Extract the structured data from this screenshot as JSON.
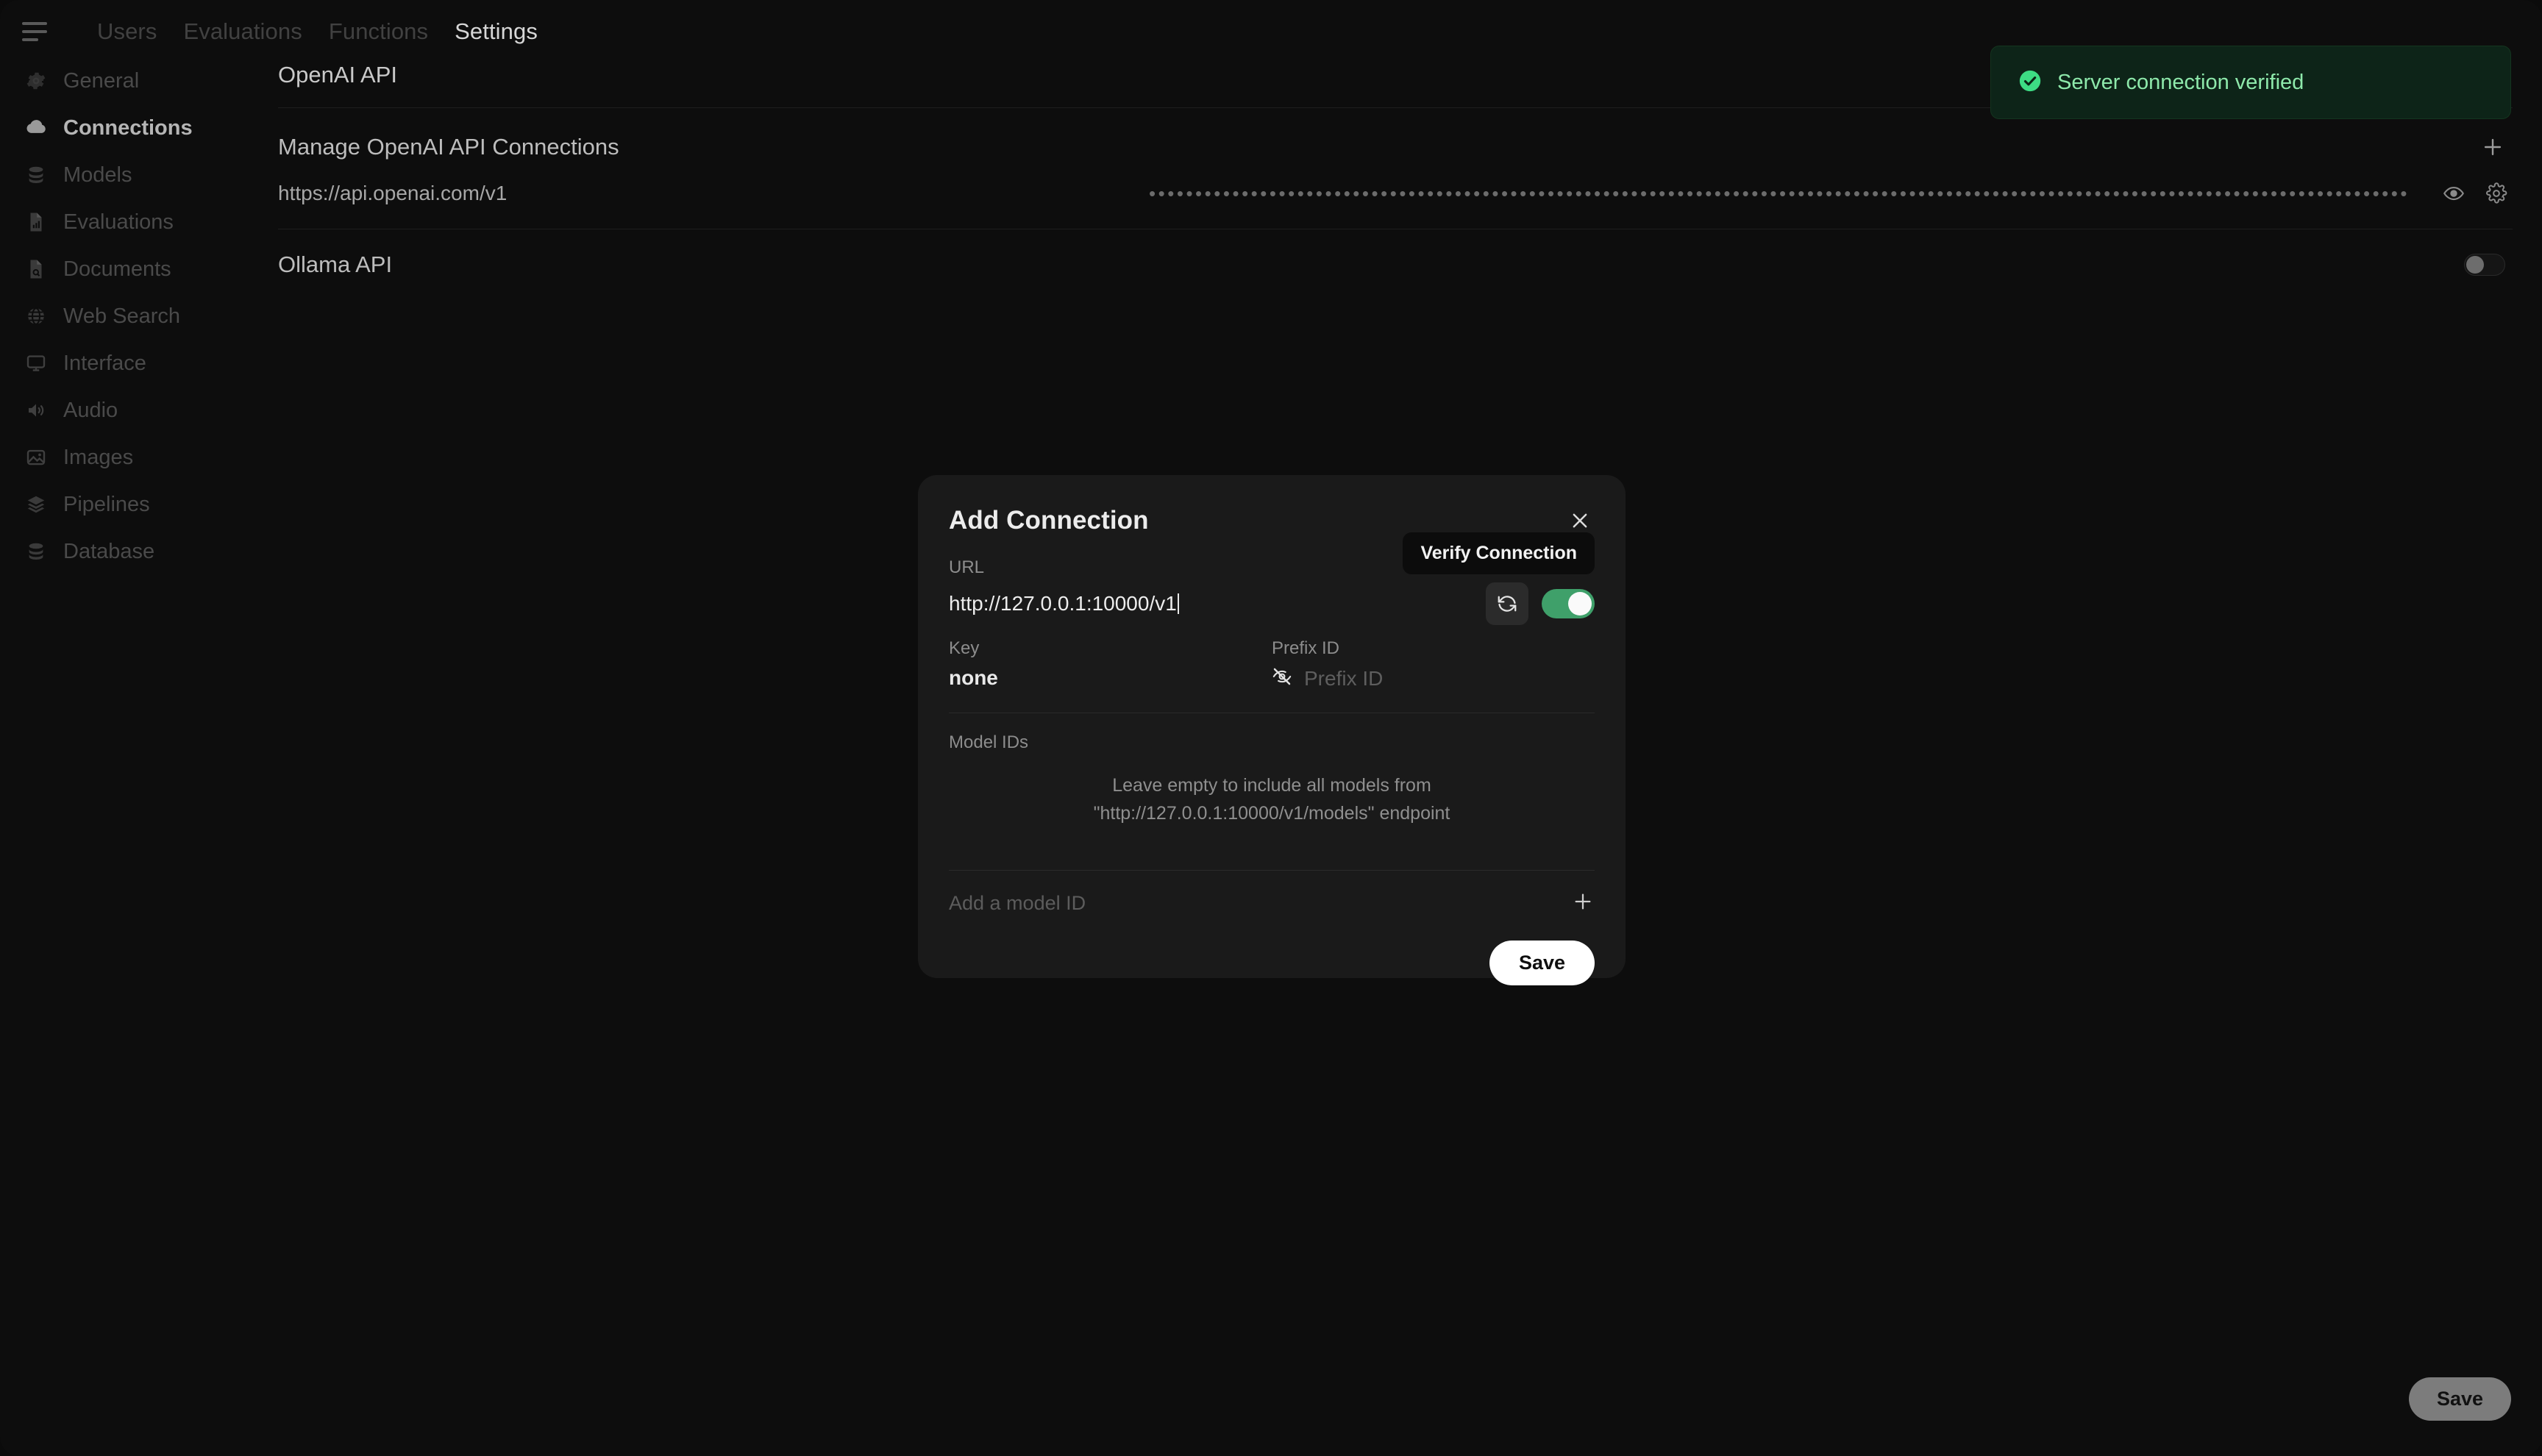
{
  "topnav": {
    "menu_icon": "hamburger-icon",
    "items": [
      {
        "label": "Users",
        "active": false
      },
      {
        "label": "Evaluations",
        "active": false
      },
      {
        "label": "Functions",
        "active": false
      },
      {
        "label": "Settings",
        "active": true
      }
    ]
  },
  "sidebar": {
    "items": [
      {
        "label": "General",
        "icon": "gear-icon",
        "active": false
      },
      {
        "label": "Connections",
        "icon": "cloud-icon",
        "active": true
      },
      {
        "label": "Models",
        "icon": "database-icon",
        "active": false
      },
      {
        "label": "Evaluations",
        "icon": "chart-doc-icon",
        "active": false
      },
      {
        "label": "Documents",
        "icon": "doc-search-icon",
        "active": false
      },
      {
        "label": "Web Search",
        "icon": "globe-icon",
        "active": false
      },
      {
        "label": "Interface",
        "icon": "monitor-icon",
        "active": false
      },
      {
        "label": "Audio",
        "icon": "speaker-icon",
        "active": false
      },
      {
        "label": "Images",
        "icon": "image-icon",
        "active": false
      },
      {
        "label": "Pipelines",
        "icon": "layers-icon",
        "active": false
      },
      {
        "label": "Database",
        "icon": "database-icon",
        "active": false
      }
    ]
  },
  "main": {
    "openai_section_title": "OpenAI API",
    "manage_title": "Manage OpenAI API Connections",
    "add_connection_icon": "plus-icon",
    "connection": {
      "url": "https://api.openai.com/v1",
      "key_masked": "••••••••••••••••••••••••••••••••••••••••••••••••••••••••••••••••••••••••••••••••••••••••••••••••••••••••••••••••••••••••••••••••••••••••",
      "reveal_icon": "eye-icon",
      "config_icon": "gear-icon"
    },
    "ollama_section_title": "Ollama API",
    "ollama_enabled": false,
    "save_label": "Save"
  },
  "toast": {
    "icon": "check-circle-icon",
    "message": "Server connection verified",
    "accent": "#8ee9ab",
    "background": "#0d2418"
  },
  "modal": {
    "title": "Add Connection",
    "close_icon": "close-icon",
    "tooltip": "Verify Connection",
    "url_label": "URL",
    "url_value": "http://127.0.0.1:10000/v1",
    "verify_icon": "refresh-icon",
    "enabled": true,
    "key_label": "Key",
    "key_value": "none",
    "prefix_label": "Prefix ID",
    "prefix_visibility_icon": "eye-off-icon",
    "prefix_placeholder": "Prefix ID",
    "model_ids_label": "Model IDs",
    "empty_hint_line1": "Leave empty to include all models from",
    "empty_hint_line2": "\"http://127.0.0.1:10000/v1/models\" endpoint",
    "add_model_placeholder": "Add a model ID",
    "add_model_icon": "plus-icon",
    "save_label": "Save"
  },
  "colors": {
    "page_bg": "#0d0d0d",
    "modal_bg": "#1a1a1a",
    "accent_green": "#3fa06a",
    "toast_green": "#8ee9ab"
  }
}
